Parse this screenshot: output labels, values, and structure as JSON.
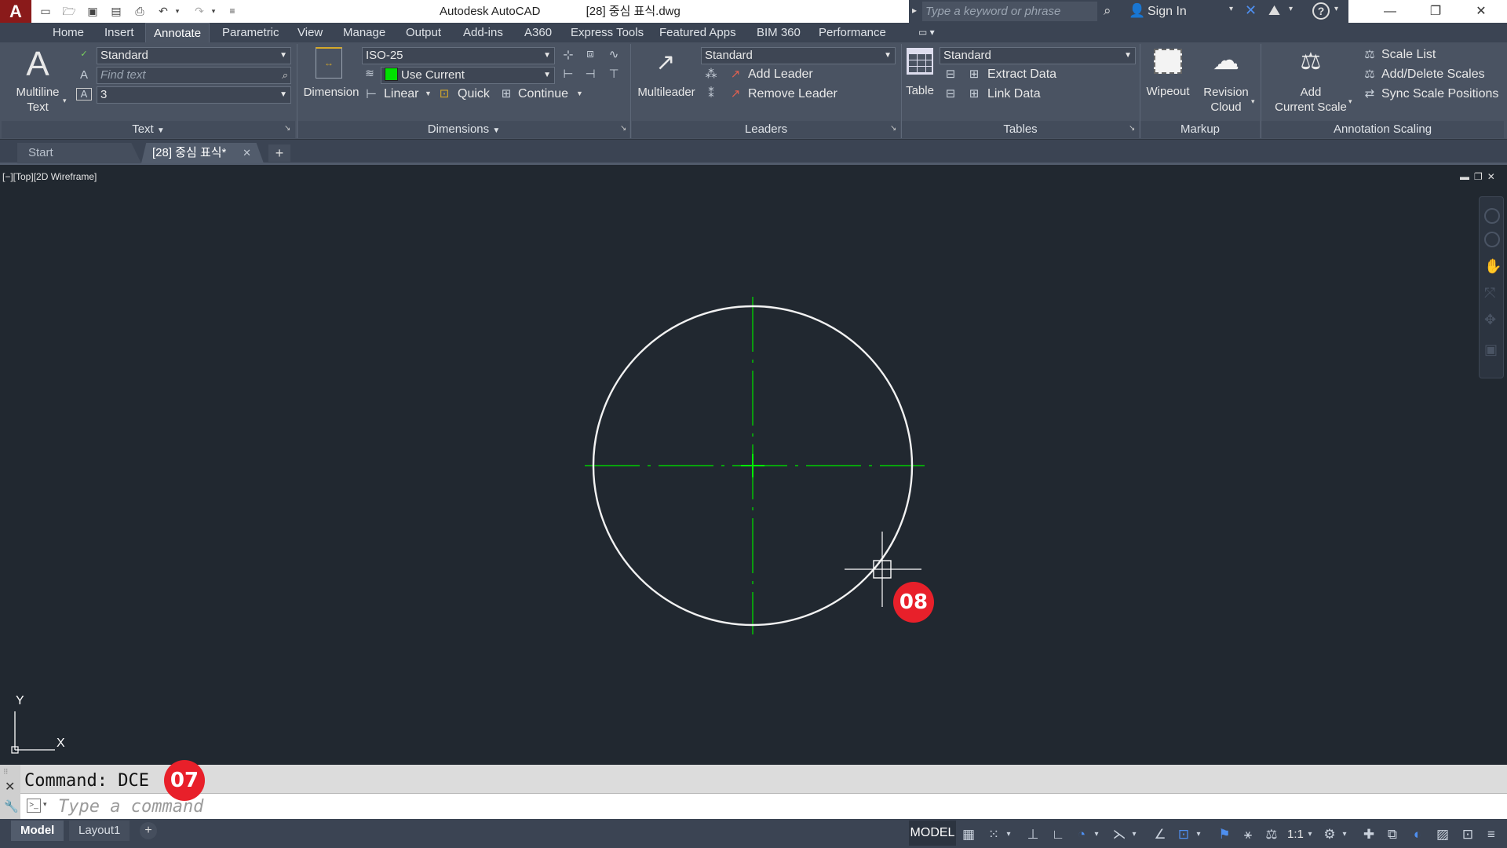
{
  "window": {
    "app_name": "Autodesk AutoCAD",
    "file_name": "[28] 중심 표식.dwg",
    "search_placeholder": "Type a keyword or phrase",
    "sign_in": "Sign In"
  },
  "ribbon_tabs": [
    "Home",
    "Insert",
    "Annotate",
    "Parametric",
    "View",
    "Manage",
    "Output",
    "Add-ins",
    "A360",
    "Express Tools",
    "Featured Apps",
    "BIM 360",
    "Performance"
  ],
  "active_tab": "Annotate",
  "panels": {
    "text": {
      "title": "Text",
      "multiline_label_1": "Multiline",
      "multiline_label_2": "Text",
      "style": "Standard",
      "find_placeholder": "Find text",
      "height": "3"
    },
    "dimensions": {
      "title": "Dimensions",
      "dimension_label": "Dimension",
      "style": "ISO-25",
      "layer": "Use Current",
      "layer_color": "#00e000",
      "linear": "Linear",
      "quick": "Quick",
      "continue": "Continue"
    },
    "leaders": {
      "title": "Leaders",
      "multileader_label": "Multileader",
      "style": "Standard",
      "add_leader": "Add Leader",
      "remove_leader": "Remove Leader"
    },
    "tables": {
      "title": "Tables",
      "table_label": "Table",
      "style": "Standard",
      "extract_data": "Extract Data",
      "link_data": "Link Data"
    },
    "markup": {
      "title": "Markup",
      "wipeout": "Wipeout",
      "revision_cloud_1": "Revision",
      "revision_cloud_2": "Cloud"
    },
    "annotation_scaling": {
      "title": "Annotation Scaling",
      "add_scale_1": "Add",
      "add_scale_2": "Current Scale",
      "scale_list": "Scale List",
      "add_delete_scales": "Add/Delete Scales",
      "sync_scale_positions": "Sync Scale Positions"
    }
  },
  "doc_tabs": {
    "start": "Start",
    "current": "[28] 중심 표식*"
  },
  "viewport_label": "[−][Top][2D Wireframe]",
  "ucs": {
    "y": "Y",
    "x": "X"
  },
  "badges": {
    "step_cursor": "08",
    "step_command": "07"
  },
  "command": {
    "history": "Command: DCE",
    "placeholder": "Type a command"
  },
  "layout_tabs": [
    "Model",
    "Layout1"
  ],
  "status": {
    "model": "MODEL",
    "scale": "1:1"
  },
  "colors": {
    "canvas": "#212830",
    "circle": "#f2f2f2",
    "centerline": "#00cc00",
    "badge": "#e8202a"
  }
}
